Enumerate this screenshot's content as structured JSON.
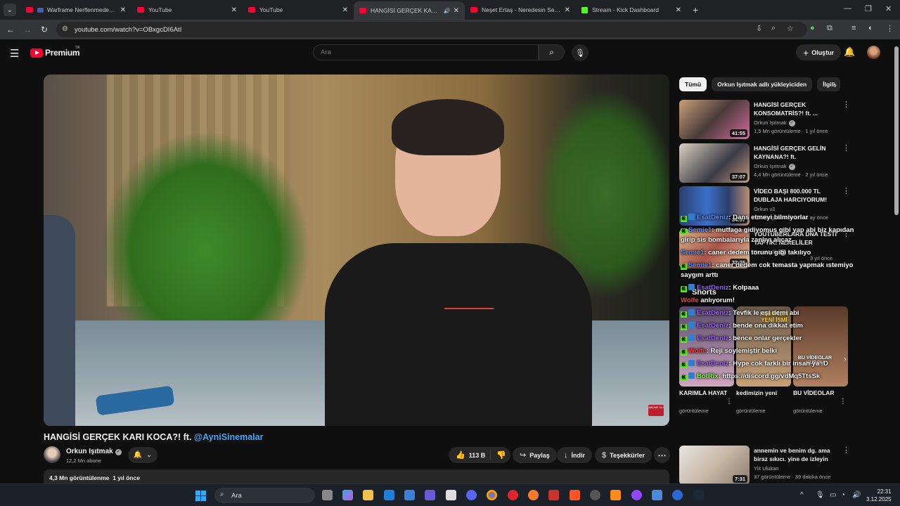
{
  "browser": {
    "tabs": [
      {
        "title": "Warframe Nerflenmeden O",
        "active": false
      },
      {
        "title": "YouTube",
        "active": false
      },
      {
        "title": "YouTube",
        "active": false
      },
      {
        "title": "HANGİSİ GERÇEK KARI KOC",
        "active": true
      },
      {
        "title": "Neşet Ertaş - Neredesin Sen (Je",
        "active": false
      },
      {
        "title": "Stream - Kick Dashboard",
        "active": false
      }
    ],
    "url": "youtube.com/watch?v=OBxgcDI6AtI"
  },
  "youtube": {
    "logo_text": "Premium",
    "logo_country": "TR",
    "search_placeholder": "Ara",
    "create_label": "Oluştur",
    "video": {
      "title": "HANGİSİ GERÇEK KARI KOCA?! ft. ",
      "title_mention": "@AyniSinemalar",
      "channel": "Orkun Işıtmak",
      "subscribers": "12,2 Mn abone",
      "likes": "113 B",
      "share_label": "Paylaş",
      "download_label": "İndir",
      "thanks_label": "Teşekkürler",
      "views": "4,3 Mn görüntülenme",
      "age": "1 yıl önce",
      "watermark": "ABONE OL!"
    },
    "chips": [
      "Tümü",
      "Orkun Işıtmak adlı yükleyiciden",
      "İlgili"
    ],
    "recommendations": [
      {
        "title": "HANGİSİ GERÇEK KONSOMATRİS?! ft. ...",
        "channel": "Orkun Işıtmak",
        "verified": true,
        "meta": "1,5 Mn görüntüleme · 1 yıl önce",
        "duration": "41:55"
      },
      {
        "title": "HANGİSİ GERÇEK GELİN KAYNANA?! ft. @AyniSinemalar",
        "channel": "Orkun Işıtmak",
        "verified": true,
        "meta": "4,4 Mn görüntüleme · 2 yıl önce",
        "duration": "37:07"
      },
      {
        "title": "VİDEO BAŞI 800.000 TL DUBLAJA HARCIYORUM! Ruhi...",
        "channel": "Orkun v2",
        "verified": false,
        "meta": "3,3 Mn görüntüleme · 2 ay önce",
        "duration": "34:57"
      },
      {
        "title": "YOUTUBERLARA DNA TESTİ YAPTIK! NERELİLER ÖĞRENDİK!",
        "channel": "TepkiKolik",
        "verified": true,
        "meta": "3 yıl önce",
        "duration": "32:26"
      }
    ],
    "shorts_label": "Shorts",
    "shorts": [
      {
        "title": "KARIMLA HAYAT",
        "views": "görüntüleme"
      },
      {
        "title": "kedimizin yeni",
        "views": "görüntüleme"
      },
      {
        "title": "BU VİDEOLAR",
        "views": "görüntüleme"
      }
    ],
    "short_thumb_text": [
      "KEDİMİZİN YENİ İSMİ",
      "BU VİDEOLAR KURGU"
    ],
    "last_rec": {
      "title": "annemin ve benim dg. ama biraz sıkıcı. yine de izleyin",
      "channel": "Yiit Ulukan",
      "meta": "37 görüntüleme · 39 dakika önce",
      "duration": "7:31"
    }
  },
  "chat": [
    {
      "user": "EsatDeniz",
      "text": ": Dans etmeyi bilmiyorlar",
      "color": "u",
      "badges": 2
    },
    {
      "user": "Semie1",
      "text": ": mutfaga gidiyomus gibi yap abi biz kapıdan",
      "color": "u",
      "badges": 1
    },
    {
      "user": "",
      "text": "girip sis bombalarıyla zanlıyı alıcaz",
      "color": "",
      "badges": 0
    },
    {
      "user": "Semie1",
      "text": ": caner dedem torunu gibi takılıyo",
      "color": "u",
      "badges": 0
    },
    {
      "user": "Semie1",
      "text": ": caner dedem cok temasta yapmak ıstemiyo",
      "color": "u",
      "badges": 1
    },
    {
      "user": "",
      "text": "saygım arttı",
      "color": "",
      "badges": 0
    },
    {
      "user": "EsatDeniz",
      "text": ": Kolpaaa",
      "color": "u2",
      "badges": 2
    },
    {
      "user": "Wolfe",
      "text": " anlıyorum!",
      "color": "u3",
      "badges": 0
    },
    {
      "user": "EsatDeniz",
      "text": ": Tevfik le eşi demi abi",
      "color": "u2",
      "badges": 2
    },
    {
      "user": "EsatDeniz",
      "text": ": bende ona dikkat etim",
      "color": "u2",
      "badges": 2
    },
    {
      "user": "EsatDeniz",
      "text": ": bence onlar gerçekler",
      "color": "u2",
      "badges": 2
    },
    {
      "user": "Wolfe",
      "text": ": Reji soylemiştir belki",
      "color": "u3",
      "badges": 1
    },
    {
      "user": "EsatDeniz",
      "text": ": Hype cok farklı bir insan ya :D",
      "color": "u2",
      "badges": 2
    },
    {
      "user": "BotRix",
      "text": ": https://discord.gg/vdMq5TtsSk",
      "color": "u4",
      "badges": 3
    }
  ],
  "taskbar": {
    "search_placeholder": "Ara",
    "time": "22:31",
    "date": "3.12.2025"
  }
}
